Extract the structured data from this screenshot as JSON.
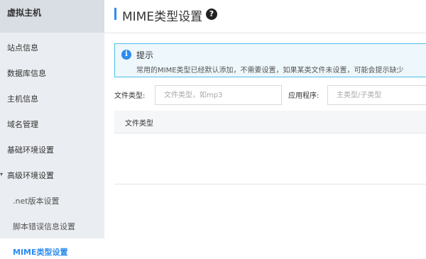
{
  "sidebar": {
    "title": "虚拟主机",
    "items": [
      {
        "label": "站点信息"
      },
      {
        "label": "数据库信息"
      },
      {
        "label": "主机信息"
      },
      {
        "label": "域名管理"
      },
      {
        "label": "基础环境设置"
      },
      {
        "label": "高级环境设置"
      },
      {
        "label": ".net版本设置"
      },
      {
        "label": "脚本错误信息设置"
      },
      {
        "label": "MIME类型设置"
      }
    ]
  },
  "header": {
    "title": "MIME类型设置",
    "help_icon": "question-circle-icon"
  },
  "notice": {
    "icon": "info-icon",
    "title": "提示",
    "text": "常用的MIME类型已经默认添加，不需要设置，如果某类文件未设置，可能会提示缺少"
  },
  "filter": {
    "file_type_label": "文件类型:",
    "file_type_placeholder": "文件类型，如mp3",
    "app_label": "应用程序:",
    "app_placeholder": "主类型/子类型"
  },
  "table": {
    "columns": [
      "文件类型"
    ],
    "rows": []
  },
  "colors": {
    "accent": "#2d8cf0",
    "sidebar_bg": "#eaedf1",
    "notice_border": "#4fbde6",
    "notice_bg": "#eef7fc"
  }
}
